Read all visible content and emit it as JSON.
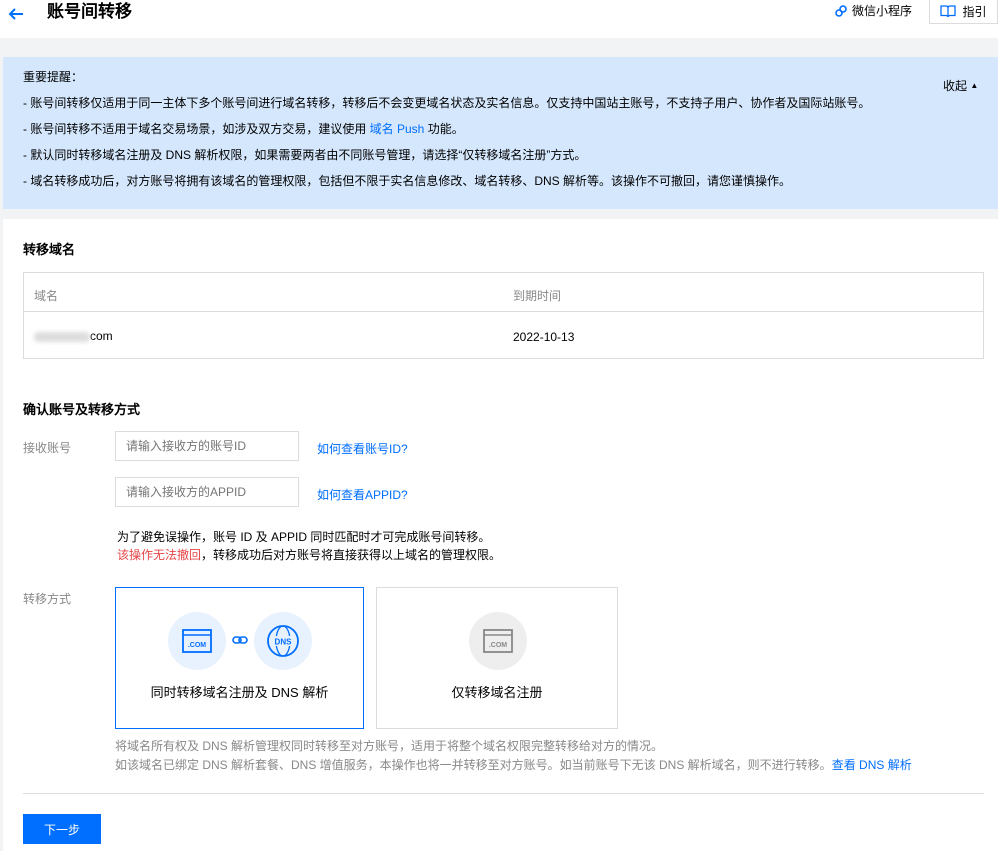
{
  "header": {
    "title": "账号间转移",
    "wechat_label": "微信小程序",
    "guide_label": "指引"
  },
  "notice": {
    "title": "重要提醒：",
    "collapse_label": "收起",
    "line1": "- 账号间转移仅适用于同一主体下多个账号间进行域名转移，转移后不会变更域名状态及实名信息。仅支持中国站主账号，不支持子用户、协作者及国际站账号。",
    "line2_pre": "- 账号间转移不适用于域名交易场景，如涉及双方交易，建议使用 ",
    "line2_link": "域名 Push",
    "line2_post": " 功能。",
    "line3": "- 默认同时转移域名注册及 DNS 解析权限，如果需要两者由不同账号管理，请选择“仅转移域名注册”方式。",
    "line4": "- 域名转移成功后，对方账号将拥有该域名的管理权限，包括但不限于实名信息修改、域名转移、DNS 解析等。该操作不可撤回，请您谨慎操作。"
  },
  "transfer_domain": {
    "title": "转移域名",
    "columns": [
      "域名",
      "到期时间"
    ],
    "rows": [
      {
        "domain_suffix": "com",
        "expires": "2022-10-13"
      }
    ]
  },
  "confirm": {
    "title": "确认账号及转移方式",
    "receive_label": "接收账号",
    "account_placeholder": "请输入接收方的账号ID",
    "account_help": "如何查看账号ID?",
    "appid_placeholder": "请输入接收方的APPID",
    "appid_help": "如何查看APPID?",
    "hint1": "为了避免误操作，账号 ID 及 APPID 同时匹配时才可完成账号间转移。",
    "hint2_red": "该操作无法撤回",
    "hint2_rest": "，转移成功后对方账号将直接获得以上域名的管理权限。",
    "method_label": "转移方式",
    "option1": "同时转移域名注册及 DNS 解析",
    "option2": "仅转移域名注册",
    "desc1": "将域名所有权及 DNS 解析管理权同时转移至对方账号，适用于将整个域名权限完整转移给对方的情况。",
    "desc2": "如该域名已绑定 DNS 解析套餐、DNS 增值服务，本操作也将一并转移至对方账号。如当前账号下无该 DNS 解析域名，则不进行转移。",
    "desc2_link": "查看 DNS 解析",
    "icon_text_com": ".COM",
    "icon_text_dns": "DNS"
  },
  "footer": {
    "next_label": "下一步"
  },
  "colors": {
    "accent": "#006eff",
    "notice_bg": "#d5e7fd",
    "danger": "#e54545"
  }
}
